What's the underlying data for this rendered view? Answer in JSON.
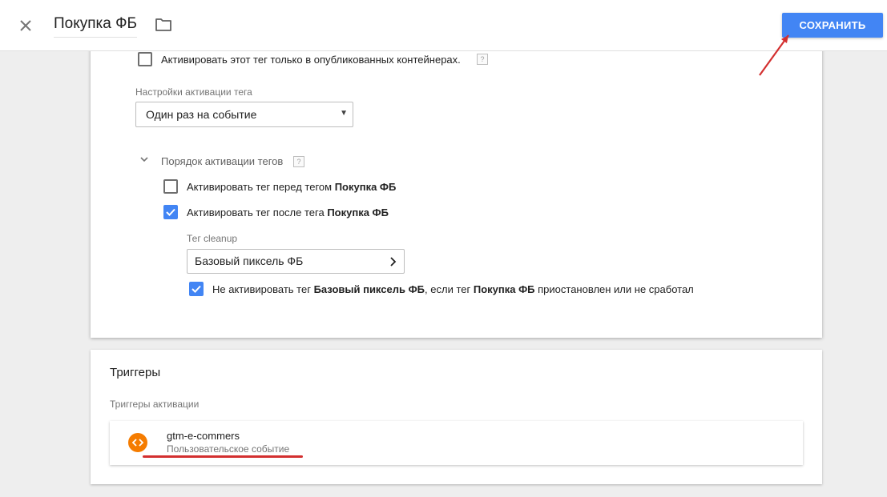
{
  "header": {
    "title": "Покупка ФБ",
    "save_label": "СОХРАНИТЬ",
    "close_icon": "close-icon",
    "folder_icon": "folder-icon"
  },
  "config": {
    "publish_only_label": "Активировать этот тег только в опубликованных контейнерах.",
    "publish_only_checked": false,
    "firing_settings_label": "Настройки активации тега",
    "firing_option_selected": "Один раз на событие",
    "sequencing_label": "Порядок активации тегов",
    "help_glyph": "?",
    "fire_before": {
      "text": "Активировать тег перед тегом ",
      "tag": "Покупка ФБ",
      "checked": false
    },
    "fire_after": {
      "text": "Активировать тег после тега ",
      "tag": "Покупка ФБ",
      "checked": true
    },
    "cleanup_label": "Тег cleanup",
    "cleanup_tag": "Базовый пиксель ФБ",
    "dont_fire": {
      "p1": "Не активировать тег ",
      "tag1": "Базовый пиксель ФБ",
      "p2": ", если тег ",
      "tag2": "Покупка ФБ",
      "p3": " приостановлен или не сработал",
      "checked": true
    }
  },
  "triggers": {
    "title": "Триггеры",
    "subtitle": "Триггеры активации",
    "items": [
      {
        "name": "gtm-e-commers",
        "type": "Пользовательское событие",
        "icon": "code-icon"
      }
    ]
  },
  "colors": {
    "accent": "#4285f4",
    "trigger_icon": "#f57c00",
    "annotation": "#d32f2f"
  }
}
